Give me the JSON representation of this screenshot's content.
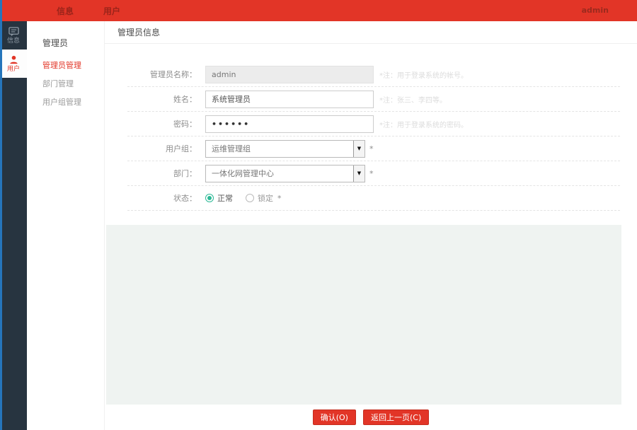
{
  "topbar": {
    "nav": [
      {
        "label": "信息"
      },
      {
        "label": "用户"
      }
    ],
    "user": "admin"
  },
  "iconbar": {
    "items": [
      {
        "label": "信息",
        "icon": "message-icon",
        "active": false
      },
      {
        "label": "用户",
        "icon": "user-icon",
        "active": true
      }
    ]
  },
  "submenu": {
    "title": "管理员",
    "items": [
      {
        "label": "管理员管理",
        "active": true
      },
      {
        "label": "部门管理",
        "active": false
      },
      {
        "label": "用户组管理",
        "active": false
      }
    ]
  },
  "main": {
    "title": "管理员信息",
    "form": {
      "rows": [
        {
          "label": "管理员名称：",
          "type": "text-disabled",
          "value": "admin",
          "hint": "*注：用于登录系统的帐号。"
        },
        {
          "label": "姓名：",
          "type": "text",
          "value": "系统管理员",
          "hint": "*注：张三、李四等。"
        },
        {
          "label": "密码：",
          "type": "password",
          "value": "••••••",
          "hint": "*注：用于登录系统的密码。"
        },
        {
          "label": "用户组：",
          "type": "select",
          "value": "运维管理组",
          "hint": "*"
        },
        {
          "label": "部门：",
          "type": "select",
          "value": "一体化网管理中心",
          "hint": "*"
        },
        {
          "label": "状态：",
          "type": "radio",
          "hint": "*",
          "options": [
            {
              "label": "正常",
              "checked": true
            },
            {
              "label": "锁定",
              "checked": false
            }
          ]
        }
      ]
    },
    "footer": {
      "confirm_label": "确认(O)",
      "back_label": "返回上一页(C)"
    }
  },
  "colors": {
    "accent_red": "#e23527",
    "sidebar_dark": "#273440",
    "edge_blue": "#2575bb",
    "radio_teal": "#2cb996",
    "content_grey": "#eff3f1"
  }
}
